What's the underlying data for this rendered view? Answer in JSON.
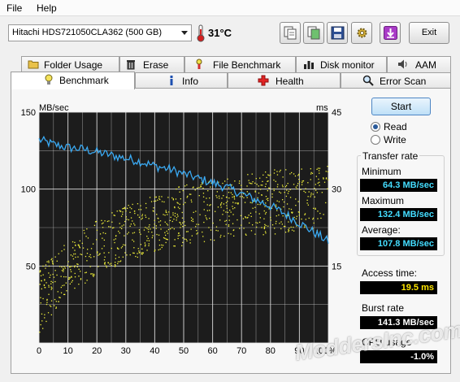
{
  "menu": {
    "file": "File",
    "help": "Help"
  },
  "toolbar": {
    "drive": "Hitachi HDS721050CLA362 (500 GB)",
    "temperature": "31°C",
    "exit_label": "Exit",
    "icons": [
      "copy-text-icon",
      "copy-screen-icon",
      "save-icon",
      "options-icon",
      "download-icon"
    ]
  },
  "tabs_top": [
    "Folder Usage",
    "Erase",
    "File Benchmark",
    "Disk monitor",
    "AAM"
  ],
  "tabs_bottom": [
    "Benchmark",
    "Info",
    "Health",
    "Error Scan"
  ],
  "active_tab": "Benchmark",
  "controls": {
    "start_label": "Start",
    "read_label": "Read",
    "write_label": "Write",
    "mode_selected": "Read"
  },
  "stats": {
    "transfer_rate_title": "Transfer rate",
    "minimum_label": "Minimum",
    "minimum_value": "64.3 MB/sec",
    "maximum_label": "Maximum",
    "maximum_value": "132.4 MB/sec",
    "average_label": "Average:",
    "average_value": "107.8 MB/sec",
    "access_time_label": "Access time:",
    "access_time_value": "19.5 ms",
    "burst_rate_label": "Burst rate",
    "burst_rate_value": "141.3 MB/sec",
    "cpu_usage_label": "CPU usage",
    "cpu_usage_value": "-1.0%"
  },
  "watermark": "ModdersInc.com",
  "colors": {
    "transfer_line": "#3aa9f2",
    "access_dots": "#f2f23a",
    "chart_bg": "#1c1c1c",
    "grid": "#e6e6e6"
  },
  "chart_data": {
    "type": "line",
    "xlabel": "",
    "ylabel_left": "MB/sec",
    "ylabel_right": "ms",
    "xlim": [
      0,
      100
    ],
    "ylim_left": [
      0,
      150
    ],
    "ylim_right": [
      0,
      45
    ],
    "x_ticks": [
      "0",
      "10",
      "20",
      "30",
      "40",
      "50",
      "60",
      "70",
      "80",
      "90",
      "100%"
    ],
    "y_ticks_left": [
      "50",
      "100",
      "150"
    ],
    "y_ticks_right": [
      "15",
      "30",
      "45"
    ],
    "grid": true,
    "series": [
      {
        "kind": "line",
        "axis": "left",
        "unit": "MB/sec",
        "x": [
          0,
          5,
          10,
          15,
          20,
          25,
          30,
          35,
          40,
          45,
          50,
          55,
          60,
          65,
          70,
          75,
          80,
          85,
          90,
          95,
          100
        ],
        "values": [
          132,
          129,
          127,
          126,
          124,
          122,
          120,
          118,
          115,
          113,
          110,
          107,
          104,
          101,
          97,
          93,
          89,
          84,
          78,
          72,
          66
        ]
      },
      {
        "kind": "scatter",
        "axis": "right",
        "unit": "ms",
        "x_range": [
          0,
          100
        ],
        "min": [
          2,
          10,
          13,
          16,
          18,
          19,
          20,
          21,
          21,
          22,
          22
        ],
        "max": [
          15,
          20,
          24,
          27,
          29,
          31,
          32,
          33,
          34,
          34,
          35
        ]
      }
    ]
  }
}
